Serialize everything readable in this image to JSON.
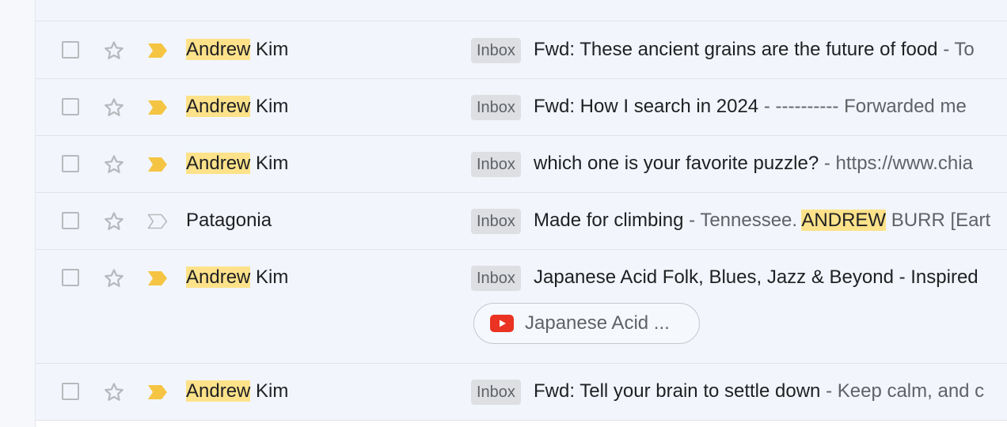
{
  "rows": [
    {
      "sender_highlight": "Andrew",
      "sender_rest": "Kim",
      "label": "Inbox",
      "subject": "Fwd: These ancient grains are the future of food",
      "snippet": "- To",
      "important": true
    },
    {
      "sender_highlight": "Andrew",
      "sender_rest": "Kim",
      "label": "Inbox",
      "subject": "Fwd: How I search in 2024",
      "snippet": "- ---------- Forwarded me",
      "important": true
    },
    {
      "sender_highlight": "Andrew",
      "sender_rest": "Kim",
      "label": "Inbox",
      "subject": "which one is your favorite puzzle?",
      "snippet": "- https://www.chia",
      "important": true
    },
    {
      "sender": "Patagonia",
      "label": "Inbox",
      "subject": "Made for climbing",
      "snippet_pre": "- Tennessee.",
      "snippet_highlight": "ANDREW",
      "snippet_post": "BURR [Eart",
      "important": false
    },
    {
      "sender_highlight": "Andrew",
      "sender_rest": "Kim",
      "label": "Inbox",
      "subject": "Japanese Acid Folk, Blues, Jazz & Beyond - Inspired",
      "attachment_label": "Japanese Acid ...",
      "attachment_icon": "youtube-icon",
      "important": true
    },
    {
      "sender_highlight": "Andrew",
      "sender_rest": "Kim",
      "label": "Inbox",
      "subject": "Fwd: Tell your brain to settle down",
      "snippet": "- Keep calm, and c",
      "important": true
    }
  ],
  "colors": {
    "important_filled": "#f5c443",
    "highlight": "#fde28a",
    "youtube_red": "#ea3323"
  }
}
